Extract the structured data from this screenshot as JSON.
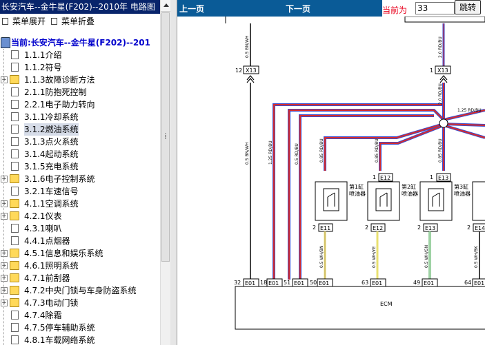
{
  "window": {
    "title": "长安汽车--金牛星(F202)--2010年 电路图"
  },
  "menu": {
    "expand_label": "菜单展开",
    "collapse_label": "菜单折叠"
  },
  "tree": {
    "current_label": "当前:长安汽车--金牛星(F202)--201",
    "items": [
      {
        "label": "1.1.1介绍",
        "type": "doc",
        "expandable": false,
        "selected": false
      },
      {
        "label": "1.1.2符号",
        "type": "doc",
        "expandable": false,
        "selected": false
      },
      {
        "label": "1.1.3故障诊断方法",
        "type": "folder",
        "expandable": true,
        "selected": false
      },
      {
        "label": "2.1.1防抱死控制",
        "type": "doc",
        "expandable": false,
        "selected": false
      },
      {
        "label": "2.2.1电子助力转向",
        "type": "doc",
        "expandable": false,
        "selected": false
      },
      {
        "label": "3.1.1冷却系统",
        "type": "doc",
        "expandable": false,
        "selected": false
      },
      {
        "label": "3.1.2燃油系统",
        "type": "doc",
        "expandable": false,
        "selected": true
      },
      {
        "label": "3.1.3点火系统",
        "type": "doc",
        "expandable": false,
        "selected": false
      },
      {
        "label": "3.1.4起动系统",
        "type": "doc",
        "expandable": false,
        "selected": false
      },
      {
        "label": "3.1.5充电系统",
        "type": "doc",
        "expandable": false,
        "selected": false
      },
      {
        "label": "3.1.6电子控制系统",
        "type": "folder",
        "expandable": true,
        "selected": false
      },
      {
        "label": "3.2.1车速信号",
        "type": "doc",
        "expandable": false,
        "selected": false
      },
      {
        "label": "4.1.1空调系统",
        "type": "folder",
        "expandable": true,
        "selected": false
      },
      {
        "label": "4.2.1仪表",
        "type": "folder",
        "expandable": true,
        "selected": false
      },
      {
        "label": "4.3.1喇叭",
        "type": "doc",
        "expandable": false,
        "selected": false
      },
      {
        "label": "4.4.1点烟器",
        "type": "doc",
        "expandable": false,
        "selected": false
      },
      {
        "label": "4.5.1信息和娱乐系统",
        "type": "folder",
        "expandable": true,
        "selected": false
      },
      {
        "label": "4.6.1照明系统",
        "type": "folder",
        "expandable": true,
        "selected": false
      },
      {
        "label": "4.7.1前刮器",
        "type": "folder",
        "expandable": true,
        "selected": false
      },
      {
        "label": "4.7.2中央门锁与车身防盗系统",
        "type": "folder",
        "expandable": true,
        "selected": false
      },
      {
        "label": "4.7.3电动门锁",
        "type": "folder",
        "expandable": true,
        "selected": false
      },
      {
        "label": "4.7.4除霜",
        "type": "doc",
        "expandable": false,
        "selected": false
      },
      {
        "label": "4.7.5停车辅助系统",
        "type": "doc",
        "expandable": false,
        "selected": false
      },
      {
        "label": "4.8.1车载网络系统",
        "type": "doc",
        "expandable": false,
        "selected": false
      }
    ]
  },
  "toolbar": {
    "prev_label": "上一页",
    "next_label": "下一页",
    "current_page_label": "当前为",
    "current_page_value": "33",
    "jump_label": "跳转"
  },
  "diagram": {
    "connectors": {
      "x13_left": {
        "pin": "12",
        "name": "X13"
      },
      "x13_right": {
        "pin": "1",
        "name": "X13"
      },
      "e12_top": {
        "pin": "1",
        "name": "E12"
      },
      "e13_top": {
        "pin": "1",
        "name": "E13"
      },
      "e11_bottom": {
        "pin": "2",
        "name": "E11"
      },
      "e12_bottom": {
        "pin": "2",
        "name": "E12"
      },
      "e13_bottom": {
        "pin": "2",
        "name": "E13"
      },
      "e14_bottom": {
        "pin": "2",
        "name": "E14"
      }
    },
    "wires": {
      "bn_wh_top": "0.5 BN/WH",
      "rd_bu_top": "2.0 RD/BU",
      "bn_wh_mid": "0.5 BN/WH",
      "rd_bu_125": "1.25 RD/BU",
      "rd_bu_05": "0.5 RD/BU",
      "rd_bu_2r": "2.0 RD/BU",
      "rd_bu_splice": "1.25 RD/BU",
      "inj1_top": "0.85 RD/BU",
      "inj2_top": "0.85 RD/BU",
      "inj3_top": "0.85 RD/BU",
      "inj1_bot": "0.5 WH/BN",
      "inj2_bot": "0.5 WH/YE",
      "inj3_bot": "0.5 WH/GN",
      "inj4_bot": "0.5 WH/BK"
    },
    "injectors": [
      {
        "label_line1": "第1缸",
        "label_line2": "喷油器"
      },
      {
        "label_line1": "第2缸",
        "label_line2": "喷油器"
      },
      {
        "label_line1": "第3缸",
        "label_line2": "喷油器"
      }
    ],
    "ecm_pins": [
      {
        "num": "32",
        "name": "E01"
      },
      {
        "num": "18",
        "name": "E01"
      },
      {
        "num": "51",
        "name": "E01"
      },
      {
        "num": "50",
        "name": "E01"
      },
      {
        "num": "63",
        "name": "E01"
      },
      {
        "num": "49",
        "name": "E01"
      },
      {
        "num": "64",
        "name": "E01"
      }
    ],
    "ecm_label": "ECM"
  },
  "colors": {
    "title_bar": "#08246b",
    "toolbar": "#0a5b97",
    "current_label": "#e8001c",
    "wire_red": "#d62c2c",
    "wire_blue": "#3a4dd0",
    "wire_yellow": "#e8e070",
    "wire_green": "#3ea64a"
  }
}
